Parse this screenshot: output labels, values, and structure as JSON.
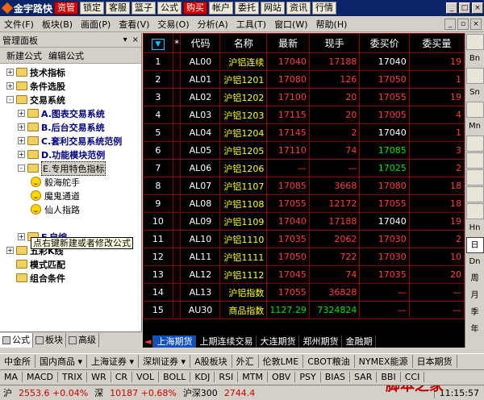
{
  "topbar": {
    "logo": "金宇路快",
    "buttons": [
      {
        "label": "资管",
        "style": "red"
      },
      {
        "label": "锁定",
        "style": ""
      },
      {
        "label": "客服",
        "style": ""
      },
      {
        "label": "篮子",
        "style": ""
      },
      {
        "label": "公式",
        "style": ""
      },
      {
        "label": "购买",
        "style": "red"
      },
      {
        "label": "帐户",
        "style": ""
      },
      {
        "label": "委托",
        "style": ""
      },
      {
        "label": "网站",
        "style": ""
      },
      {
        "label": "资讯",
        "style": ""
      },
      {
        "label": "行情",
        "style": ""
      }
    ]
  },
  "menubar": {
    "items": [
      "文件(F)",
      "板块(B)",
      "画面(P)",
      "查看(V)",
      "交易(O)",
      "分析(A)",
      "工具(T)",
      "窗口(W)",
      "帮助(H)"
    ]
  },
  "leftpanel": {
    "title": "管理面板",
    "tools": [
      "新建公式",
      "编辑公式"
    ],
    "tree": [
      {
        "label": "技术指标",
        "level": 0,
        "exp": "+",
        "icon": "folder",
        "style": "bold"
      },
      {
        "label": "条件选股",
        "level": 0,
        "exp": "+",
        "icon": "folder",
        "style": "bold"
      },
      {
        "label": "交易系统",
        "level": 0,
        "exp": "-",
        "icon": "folder",
        "style": "bold"
      },
      {
        "label": "A.图表交易系统",
        "level": 1,
        "exp": "+",
        "icon": "folder",
        "style": "navy"
      },
      {
        "label": "B.后台交易系统",
        "level": 1,
        "exp": "+",
        "icon": "folder",
        "style": "navy"
      },
      {
        "label": "C.套利交易系统范例",
        "level": 1,
        "exp": "+",
        "icon": "folder",
        "style": "navy"
      },
      {
        "label": "D.功能模块范例",
        "level": 1,
        "exp": "+",
        "icon": "folder",
        "style": "navy"
      },
      {
        "label": "E.专用特色指标",
        "level": 1,
        "exp": "-",
        "icon": "folder",
        "style": "sel"
      },
      {
        "label": "毅海舵手",
        "level": 2,
        "exp": "",
        "icon": "smile",
        "style": ""
      },
      {
        "label": "魔鬼通道",
        "level": 2,
        "exp": "",
        "icon": "smile",
        "style": ""
      },
      {
        "label": "仙人指路",
        "level": 2,
        "exp": "",
        "icon": "smile",
        "style": ""
      },
      {
        "label": "",
        "level": 2,
        "exp": "",
        "icon": "none",
        "style": ""
      },
      {
        "label": "F.自编",
        "level": 1,
        "exp": "+",
        "icon": "folder",
        "style": "navy"
      },
      {
        "label": "五彩K线",
        "level": 0,
        "exp": "+",
        "icon": "folder",
        "style": "bold"
      },
      {
        "label": "模式匹配",
        "level": 0,
        "exp": "",
        "icon": "folder",
        "style": "bold"
      },
      {
        "label": "组合条件",
        "level": 0,
        "exp": "",
        "icon": "folder",
        "style": "bold"
      }
    ],
    "tooltip": "点右键新建或者修改公式",
    "tabs": [
      {
        "label": "公式",
        "active": true
      },
      {
        "label": "板块",
        "active": false
      },
      {
        "label": "高级",
        "active": false
      }
    ]
  },
  "table": {
    "headers": [
      "",
      "*",
      "代码",
      "名称",
      "最新",
      "现手",
      "委买价",
      "委买量"
    ],
    "dropdown_glyph": "▼",
    "rows": [
      {
        "idx": "1",
        "code": "AL00",
        "name": "沪铝连续",
        "last": "17040",
        "last_c": "red",
        "vol": "17188",
        "vol_c": "red",
        "bid": "17040",
        "bid_c": "white",
        "bq": "19",
        "bq_c": "red"
      },
      {
        "idx": "2",
        "code": "AL01",
        "name": "沪铝1201",
        "last": "17080",
        "last_c": "red",
        "vol": "126",
        "vol_c": "red",
        "bid": "17050",
        "bid_c": "red",
        "bq": "1",
        "bq_c": "red"
      },
      {
        "idx": "3",
        "code": "AL02",
        "name": "沪铝1202",
        "last": "17100",
        "last_c": "red",
        "vol": "20",
        "vol_c": "red",
        "bid": "17055",
        "bid_c": "red",
        "bq": "19",
        "bq_c": "red"
      },
      {
        "idx": "4",
        "code": "AL03",
        "name": "沪铝1203",
        "last": "17115",
        "last_c": "red",
        "vol": "20",
        "vol_c": "red",
        "bid": "17005",
        "bid_c": "red",
        "bq": "4",
        "bq_c": "red"
      },
      {
        "idx": "5",
        "code": "AL04",
        "name": "沪铝1204",
        "last": "17145",
        "last_c": "red",
        "vol": "2",
        "vol_c": "red",
        "bid": "17040",
        "bid_c": "white",
        "bq": "1",
        "bq_c": "red"
      },
      {
        "idx": "6",
        "code": "AL05",
        "name": "沪铝1205",
        "last": "17110",
        "last_c": "red",
        "vol": "74",
        "vol_c": "red",
        "bid": "17085",
        "bid_c": "green",
        "bq": "3",
        "bq_c": "red"
      },
      {
        "idx": "7",
        "code": "AL06",
        "name": "沪铝1206",
        "last": "—",
        "last_c": "red",
        "vol": "—",
        "vol_c": "red",
        "bid": "17025",
        "bid_c": "green",
        "bq": "2",
        "bq_c": "red"
      },
      {
        "idx": "8",
        "code": "AL07",
        "name": "沪铝1107",
        "last": "17085",
        "last_c": "red",
        "vol": "3668",
        "vol_c": "red",
        "bid": "17080",
        "bid_c": "red",
        "bq": "18",
        "bq_c": "red"
      },
      {
        "idx": "9",
        "code": "AL08",
        "name": "沪铝1108",
        "last": "17055",
        "last_c": "red",
        "vol": "12172",
        "vol_c": "red",
        "bid": "17055",
        "bid_c": "red",
        "bq": "18",
        "bq_c": "red"
      },
      {
        "idx": "10",
        "code": "AL09",
        "name": "沪铝1109",
        "last": "17040",
        "last_c": "red",
        "vol": "17188",
        "vol_c": "red",
        "bid": "17040",
        "bid_c": "white",
        "bq": "19",
        "bq_c": "red"
      },
      {
        "idx": "11",
        "code": "AL10",
        "name": "沪铝1110",
        "last": "17035",
        "last_c": "red",
        "vol": "2062",
        "vol_c": "red",
        "bid": "17030",
        "bid_c": "red",
        "bq": "2",
        "bq_c": "red"
      },
      {
        "idx": "12",
        "code": "AL11",
        "name": "沪铝1111",
        "last": "17050",
        "last_c": "red",
        "vol": "722",
        "vol_c": "red",
        "bid": "17030",
        "bid_c": "red",
        "bq": "10",
        "bq_c": "red"
      },
      {
        "idx": "13",
        "code": "AL12",
        "name": "沪铝1112",
        "last": "17045",
        "last_c": "red",
        "vol": "74",
        "vol_c": "red",
        "bid": "17035",
        "bid_c": "red",
        "bq": "20",
        "bq_c": "red"
      },
      {
        "idx": "14",
        "code": "AL13",
        "name": "沪铝指数",
        "last": "17055",
        "last_c": "red",
        "vol": "36828",
        "vol_c": "red",
        "bid": "—",
        "bid_c": "red",
        "bq": "—",
        "bq_c": "red"
      },
      {
        "idx": "15",
        "code": "AU30",
        "name": "商品指数",
        "last": "1127.29",
        "last_c": "green",
        "vol": "7324824",
        "vol_c": "green",
        "bid": "—",
        "bid_c": "red",
        "bq": "—",
        "bq_c": "red"
      }
    ]
  },
  "rightbar": {
    "items": [
      {
        "label": "",
        "kind": "ico"
      },
      {
        "label": "Bn",
        "kind": "text"
      },
      {
        "label": "",
        "kind": "ico"
      },
      {
        "label": "Sn",
        "kind": "text"
      },
      {
        "label": "",
        "kind": "ico"
      },
      {
        "label": "Mn",
        "kind": "text"
      },
      {
        "label": "",
        "kind": "ico"
      },
      {
        "label": "",
        "kind": "ico"
      },
      {
        "label": "",
        "kind": "ico"
      },
      {
        "label": "",
        "kind": "ico"
      },
      {
        "label": "",
        "kind": "ico"
      },
      {
        "label": "Hn",
        "kind": "text"
      },
      {
        "label": "日",
        "kind": "pressed"
      },
      {
        "label": "Dn",
        "kind": "text"
      },
      {
        "label": "周",
        "kind": "text"
      },
      {
        "label": "月",
        "kind": "text"
      },
      {
        "label": "季",
        "kind": "text"
      },
      {
        "label": "年",
        "kind": "text"
      }
    ]
  },
  "market_tabs": [
    {
      "label": "◄",
      "active": false,
      "first": true
    },
    {
      "label": "上海期货",
      "active": true,
      "first": false
    },
    {
      "label": "上期连续交易",
      "active": false,
      "first": false
    },
    {
      "label": "大连期货",
      "active": false,
      "first": false
    },
    {
      "label": "郑州期货",
      "active": false,
      "first": false
    },
    {
      "label": "金融期",
      "active": false,
      "first": false
    }
  ],
  "exchange_row": [
    "中金所",
    "国内商品 ▾",
    "上海证券 ▾",
    "深圳证券 ▾",
    "A股板块",
    "外汇",
    "伦敦LME",
    "CBOT粮油",
    "NYMEX能源",
    "日本期货"
  ],
  "indicator_row": [
    "MA",
    "MACD",
    "TRIX",
    "WR",
    "CR",
    "VOL",
    "BOLL",
    "KDJ",
    "RSI",
    "MTM",
    "OBV",
    "PSY",
    "BIAS",
    "SAR",
    "BBI",
    "CCI"
  ],
  "status": {
    "sh_label": "沪",
    "sh_value": "2553.6 +0.04%",
    "sz_label": "深",
    "sz_value": "10187 +0.68%",
    "hs_label": "沪深300",
    "hs_value": "2744.4",
    "watermark": "脚本之家",
    "clock": "11:15:57"
  }
}
